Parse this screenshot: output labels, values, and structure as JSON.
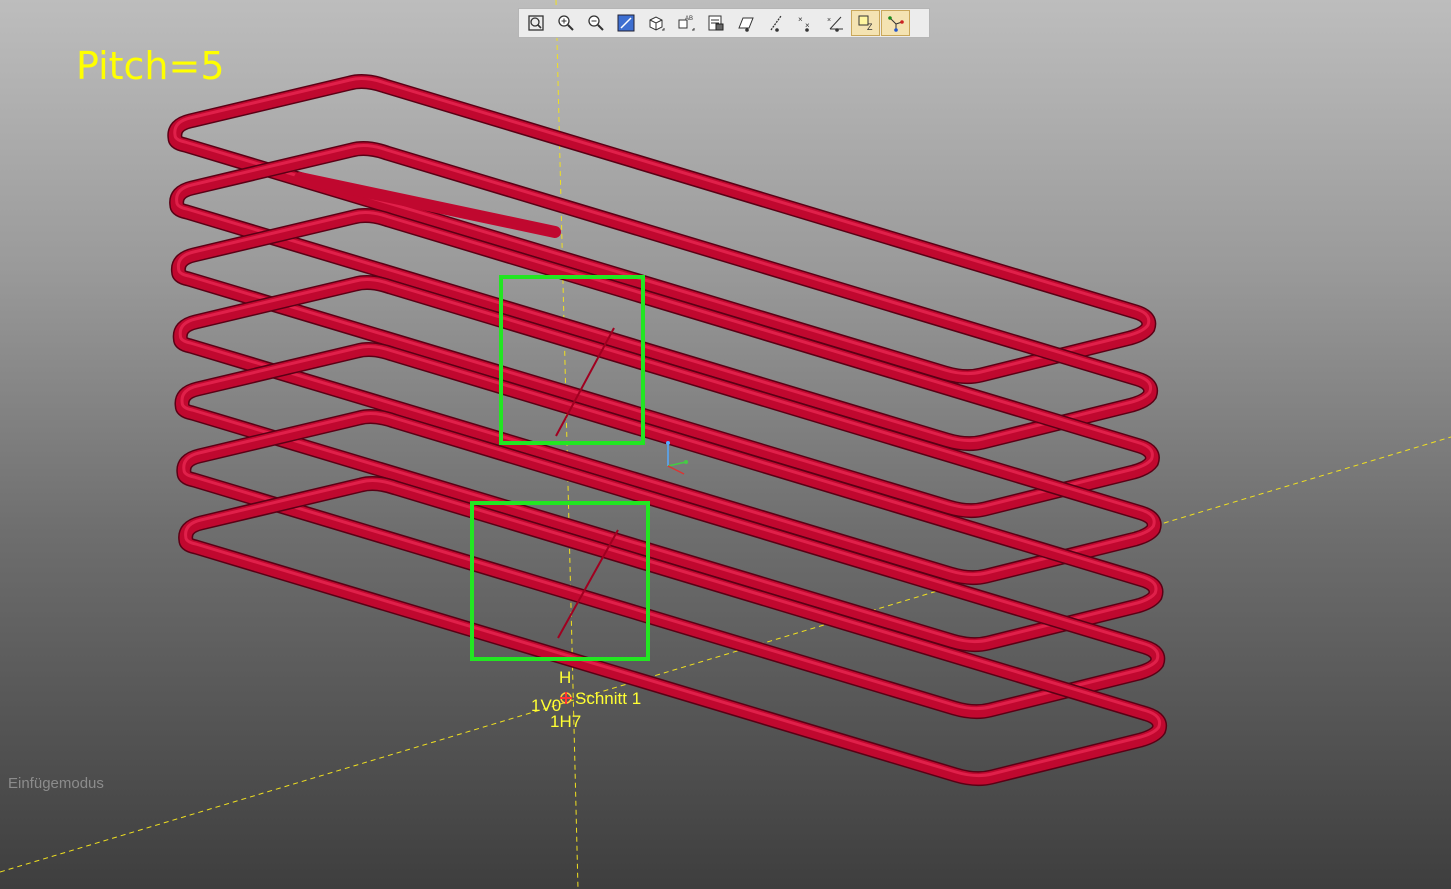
{
  "viewport": {
    "pitch_label": "Pitch=5",
    "mode_label": "Einfügemodus",
    "section": {
      "marker_top": "H",
      "label": "Schnitt 1",
      "marker_left": "1V0",
      "marker_bottom": "1H7"
    },
    "colors": {
      "coil": "#c0082f",
      "selection_box": "#22e622",
      "axis_lines": "#f0e020",
      "label_text": "#ffff00"
    },
    "coil_turns": 7
  },
  "toolbar": {
    "buttons": [
      {
        "name": "zoom-fit-icon",
        "active": false
      },
      {
        "name": "zoom-in-icon",
        "active": false
      },
      {
        "name": "zoom-out-icon",
        "active": false
      },
      {
        "name": "zoom-window-icon",
        "active": false
      },
      {
        "name": "view-cube-icon",
        "active": false
      },
      {
        "name": "labels-icon",
        "active": false
      },
      {
        "name": "screenshot-icon",
        "active": false
      },
      {
        "name": "show-planes-icon",
        "active": false
      },
      {
        "name": "show-axes-icon",
        "active": false
      },
      {
        "name": "show-points-icon",
        "active": false
      },
      {
        "name": "show-csys-icon",
        "active": false
      },
      {
        "name": "dim-display-icon",
        "active": true
      },
      {
        "name": "snap-mode-icon",
        "active": true
      }
    ]
  }
}
